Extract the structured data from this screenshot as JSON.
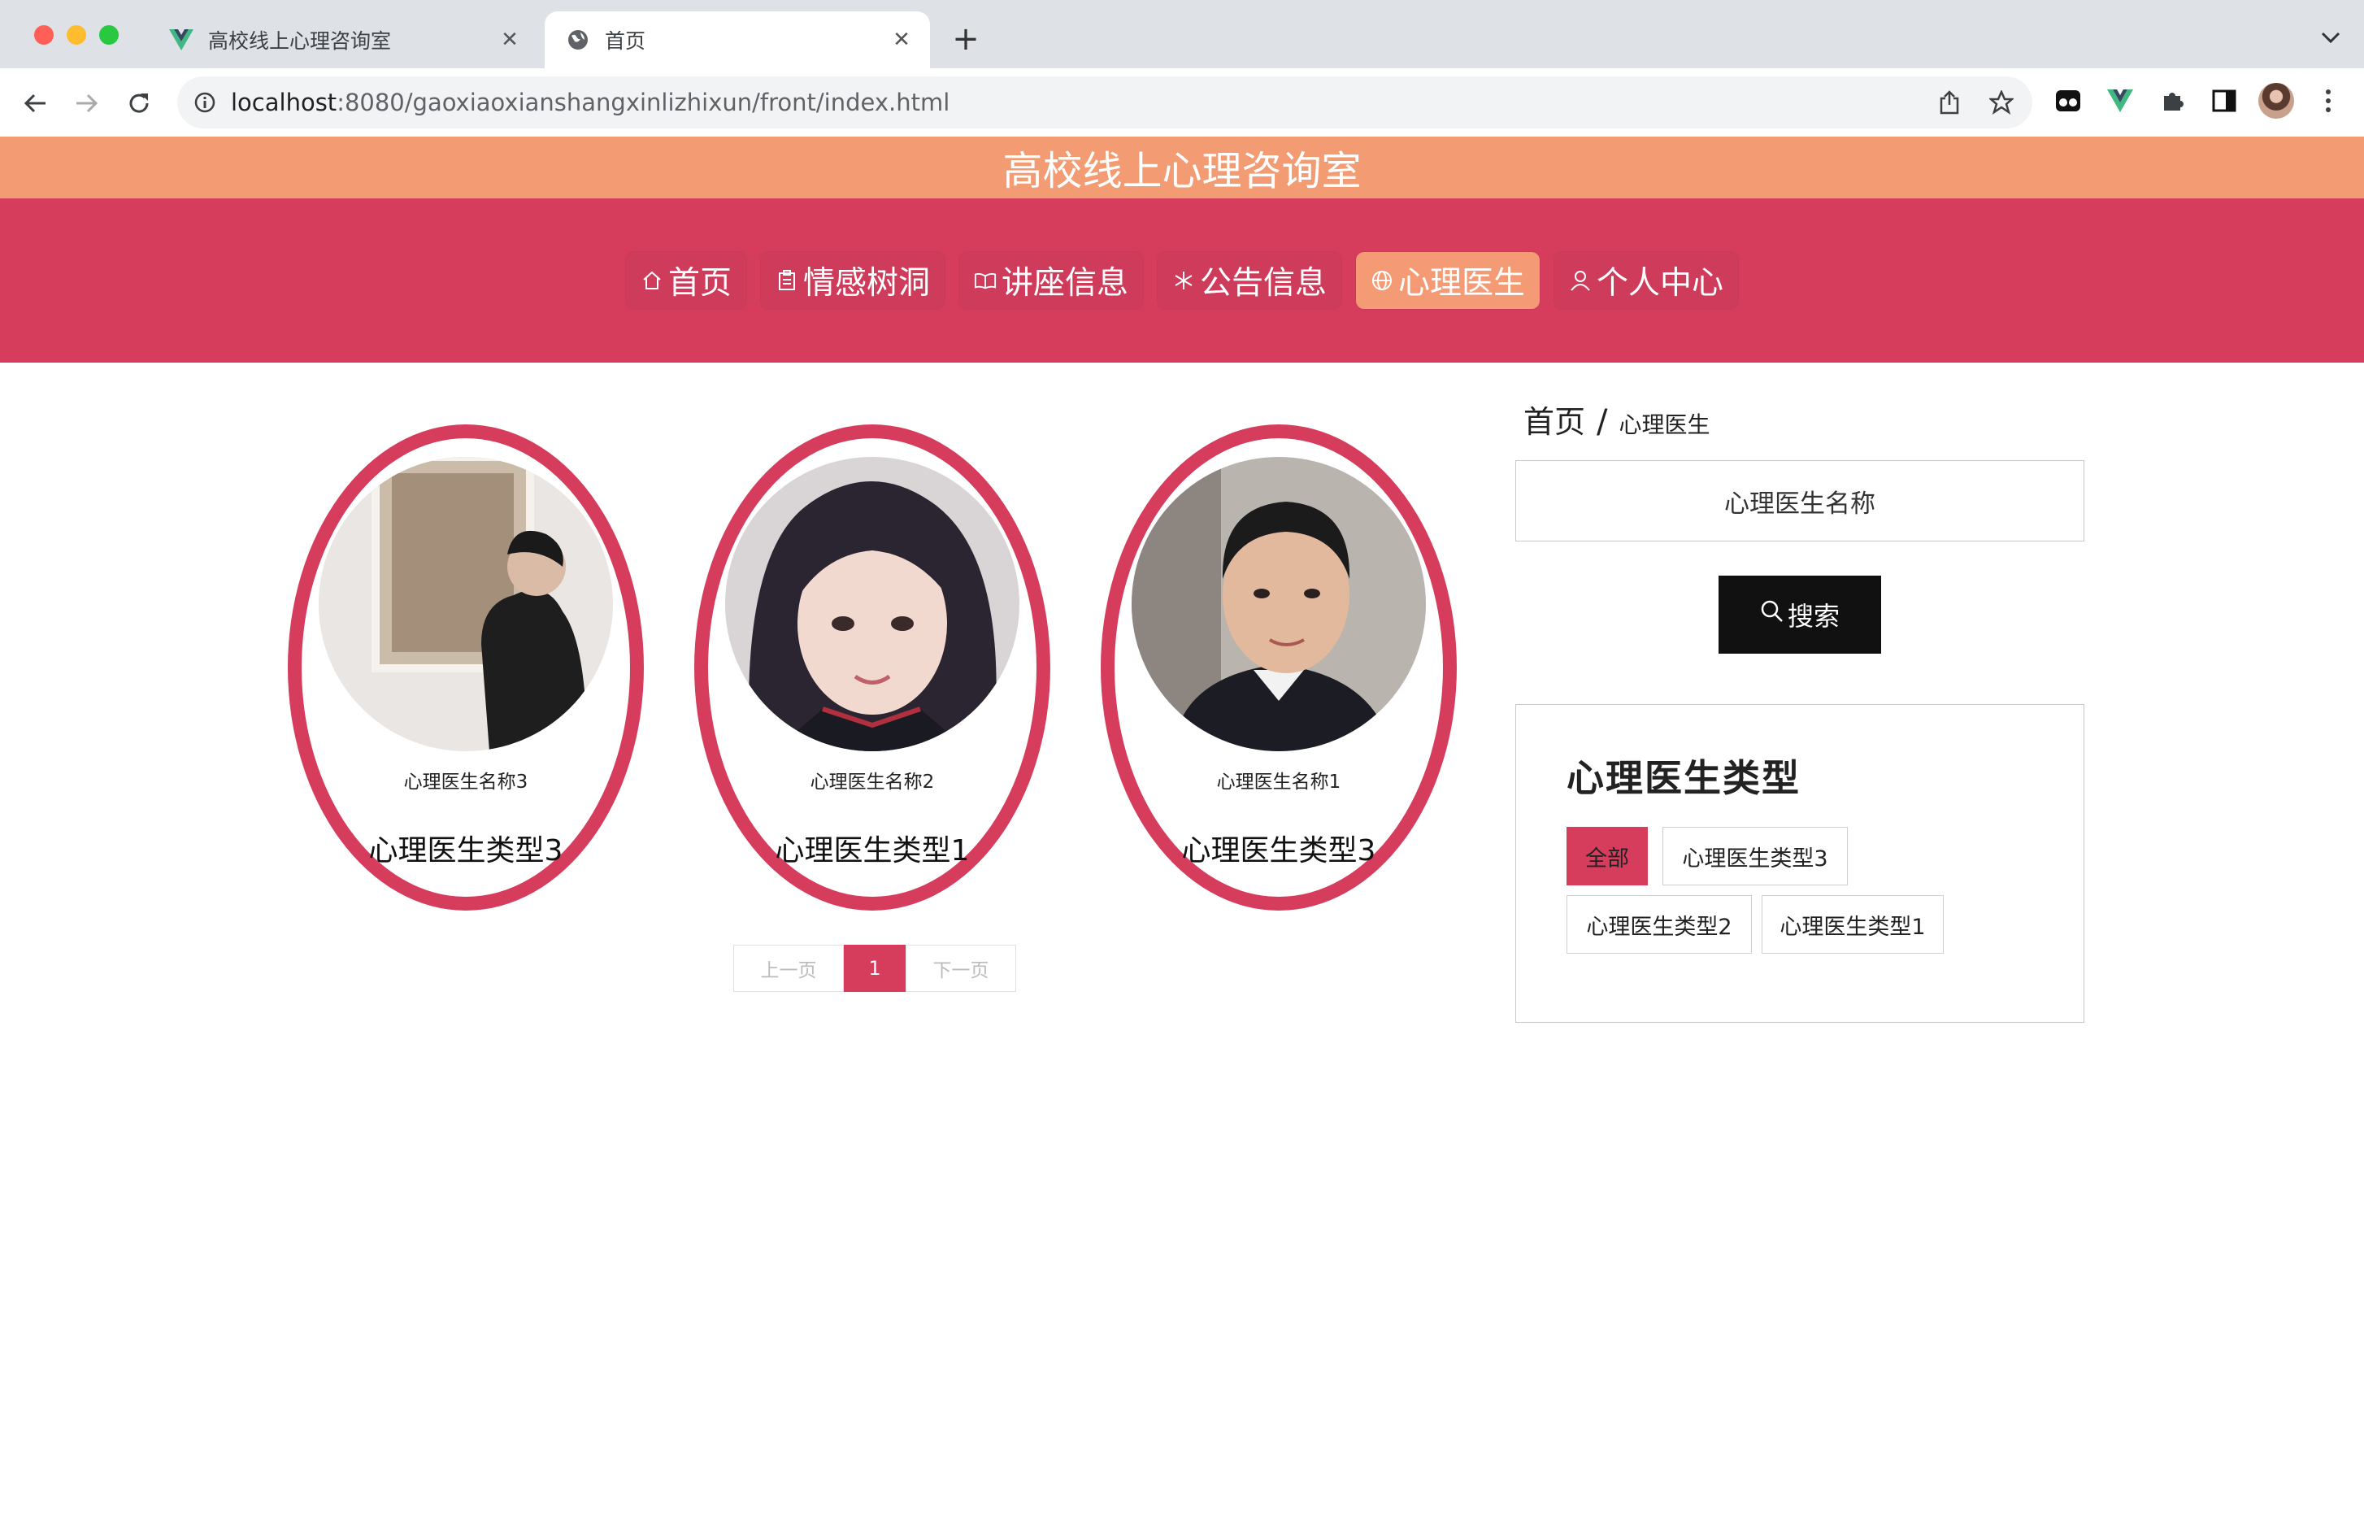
{
  "browser": {
    "tabs": [
      {
        "title": "高校线上心理咨询室",
        "active": false,
        "icon": "vue-logo-icon"
      },
      {
        "title": "首页",
        "active": true,
        "icon": "globe-icon"
      }
    ],
    "url_host": "localhost",
    "url_rest": ":8080/gaoxiaoxianshangxinlizhixun/front/index.html"
  },
  "site": {
    "title": "高校线上心理咨询室"
  },
  "nav": {
    "items": [
      {
        "label": "首页",
        "icon": "home-icon",
        "active": false
      },
      {
        "label": "情感树洞",
        "icon": "clipboard-icon",
        "active": false
      },
      {
        "label": "讲座信息",
        "icon": "book-icon",
        "active": false
      },
      {
        "label": "公告信息",
        "icon": "snowflake-icon",
        "active": false
      },
      {
        "label": "心理医生",
        "icon": "globe-icon",
        "active": true
      },
      {
        "label": "个人中心",
        "icon": "user-icon",
        "active": false
      }
    ]
  },
  "doctors": [
    {
      "name": "心理医生名称3",
      "type": "心理医生类型3"
    },
    {
      "name": "心理医生名称2",
      "type": "心理医生类型1"
    },
    {
      "name": "心理医生名称1",
      "type": "心理医生类型3"
    }
  ],
  "pagination": {
    "prev": "上一页",
    "current": "1",
    "next": "下一页"
  },
  "breadcrumb": {
    "home": "首页",
    "separator": "/",
    "current": "心理医生"
  },
  "search": {
    "placeholder": "心理医生名称",
    "button": "搜索"
  },
  "type_filter": {
    "title": "心理医生类型",
    "options": [
      {
        "label": "全部",
        "active": true
      },
      {
        "label": "心理医生类型3",
        "active": false
      },
      {
        "label": "心理医生类型2",
        "active": false
      },
      {
        "label": "心理医生类型1",
        "active": false
      }
    ]
  },
  "colors": {
    "accent": "#d63d5d",
    "header_orange": "#f39b72",
    "active_nav": "#f49a74"
  }
}
